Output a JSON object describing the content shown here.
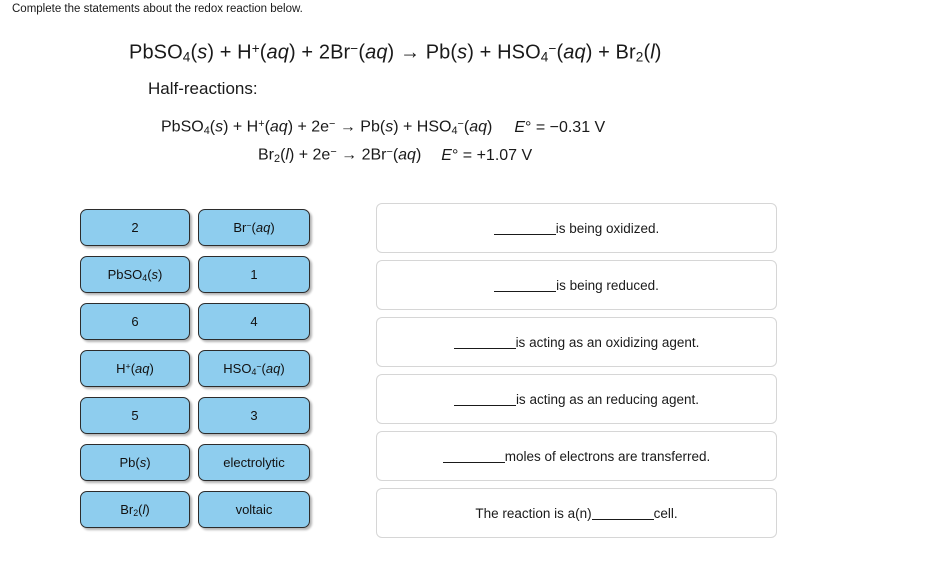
{
  "prompt": "Complete the statements about the redox reaction below.",
  "equation": {
    "overall": "PbSO4(s) + H+(aq) + 2Br-(aq) → Pb(s) + HSO4-(aq) + Br2(l)",
    "half_label": "Half-reactions:",
    "half_reaction_1": "PbSO4(s) + H+(aq) + 2e- → Pb(s) + HSO4-(aq)",
    "half_reaction_1_potential": "E° = −0.31 V",
    "half_reaction_2": "Br2(l) + 2e- → 2Br-(aq)",
    "half_reaction_2_potential": "E° = +1.07 V"
  },
  "tiles": [
    {
      "id": "tile-2",
      "column": 1,
      "row": 0,
      "label": "2"
    },
    {
      "id": "tile-pbso4-s",
      "column": 1,
      "row": 1,
      "label": "PbSO4(s)"
    },
    {
      "id": "tile-6",
      "column": 1,
      "row": 2,
      "label": "6"
    },
    {
      "id": "tile-h-plus-aq",
      "column": 1,
      "row": 3,
      "label": "H+(aq)"
    },
    {
      "id": "tile-5",
      "column": 1,
      "row": 4,
      "label": "5"
    },
    {
      "id": "tile-pb-s",
      "column": 1,
      "row": 5,
      "label": "Pb(s)"
    },
    {
      "id": "tile-br2-l",
      "column": 1,
      "row": 6,
      "label": "Br2(l)"
    },
    {
      "id": "tile-br-minus-aq",
      "column": 2,
      "row": 0,
      "label": "Br-(aq)"
    },
    {
      "id": "tile-1",
      "column": 2,
      "row": 1,
      "label": "1"
    },
    {
      "id": "tile-4",
      "column": 2,
      "row": 2,
      "label": "4"
    },
    {
      "id": "tile-hso4-minus-aq",
      "column": 2,
      "row": 3,
      "label": "HSO4-(aq)"
    },
    {
      "id": "tile-3",
      "column": 2,
      "row": 4,
      "label": "3"
    },
    {
      "id": "tile-electrolytic",
      "column": 2,
      "row": 5,
      "label": "electrolytic"
    },
    {
      "id": "tile-voltaic",
      "column": 2,
      "row": 6,
      "label": "voltaic"
    }
  ],
  "answer_slots": [
    {
      "id": "slot-oxidized",
      "before": "",
      "after": " is being oxidized."
    },
    {
      "id": "slot-reduced",
      "before": "",
      "after": " is being reduced."
    },
    {
      "id": "slot-oxidizing-agent",
      "before": "",
      "after": "is acting as an oxidizing agent."
    },
    {
      "id": "slot-reducing-agent",
      "before": "",
      "after": "is acting as an reducing agent."
    },
    {
      "id": "slot-moles-electrons",
      "before": "",
      "after": " moles of electrons are transferred."
    },
    {
      "id": "slot-cell-type",
      "before": "The reaction is a(n) ",
      "after": " cell."
    }
  ],
  "colors": {
    "tile_fill": "#8ecdee",
    "tile_border": "#2c2c2c",
    "slot_border": "#d6d6d6",
    "text": "#1a1a1a",
    "page_background": "#ffffff"
  }
}
